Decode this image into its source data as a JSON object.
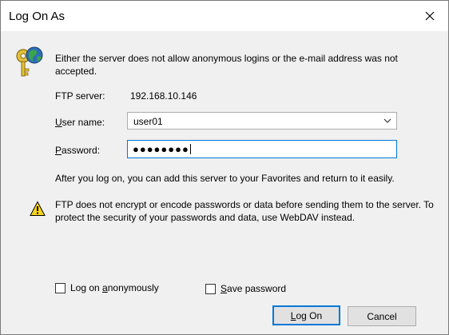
{
  "window": {
    "title": "Log On As"
  },
  "message": "Either the server does not allow anonymous logins or the e-mail address was not accepted.",
  "server": {
    "label": "FTP server:",
    "value": "192.168.10.146"
  },
  "username": {
    "label_mnemonic": "U",
    "label_rest": "ser name:",
    "value": "user01"
  },
  "password": {
    "label_mnemonic": "P",
    "label_rest": "assword:",
    "masked_value": "●●●●●●●●"
  },
  "info": "After you log on, you can add this server to your Favorites and return to it easily.",
  "warning": "FTP does not encrypt or encode passwords or data before sending them to the server.  To protect the security of your passwords and data, use WebDAV instead.",
  "options": {
    "anonymous": {
      "pre": "Log on ",
      "mnemonic": "a",
      "post": "nonymously",
      "checked": false
    },
    "save_password": {
      "mnemonic": "S",
      "post": "ave password",
      "checked": false
    }
  },
  "buttons": {
    "logon": {
      "mnemonic": "L",
      "post": "og On"
    },
    "cancel": "Cancel"
  },
  "icons": {
    "close": "close-icon",
    "key": "key-globe-icon",
    "warning": "warning-icon",
    "dropdown": "chevron-down-icon"
  },
  "colors": {
    "focus_border": "#0078d7",
    "button_face": "#e1e1e1",
    "dialog_bg": "#f0f0f0"
  }
}
